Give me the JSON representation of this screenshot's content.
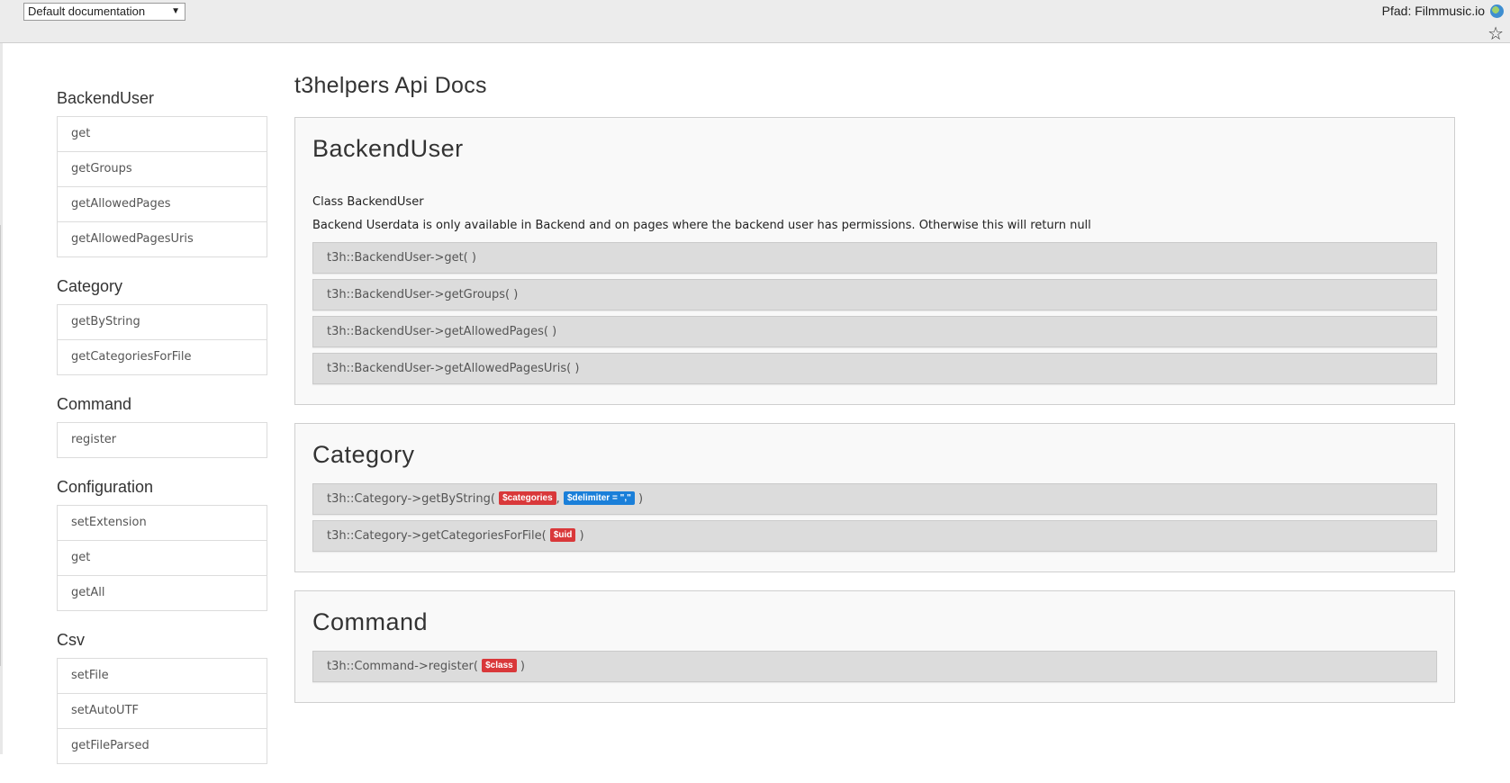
{
  "topbar": {
    "doc_select": "Default documentation",
    "pfad": "Pfad: Filmmusic.io"
  },
  "page_title": "t3helpers Api Docs",
  "sidebar": [
    {
      "title": "BackendUser",
      "items": [
        "get",
        "getGroups",
        "getAllowedPages",
        "getAllowedPagesUris"
      ]
    },
    {
      "title": "Category",
      "items": [
        "getByString",
        "getCategoriesForFile"
      ]
    },
    {
      "title": "Command",
      "items": [
        "register"
      ]
    },
    {
      "title": "Configuration",
      "items": [
        "setExtension",
        "get",
        "getAll"
      ]
    },
    {
      "title": "Csv",
      "items": [
        "setFile",
        "setAutoUTF",
        "getFileParsed"
      ]
    }
  ],
  "panels": [
    {
      "title": "BackendUser",
      "class_line": "Class BackendUser",
      "description": "Backend Userdata is only available in Backend and on pages where the backend user has permissions. Otherwise this will return null",
      "methods": [
        {
          "call": "t3h::BackendUser->get(",
          "params": [],
          "close": ")"
        },
        {
          "call": "t3h::BackendUser->getGroups(",
          "params": [],
          "close": ")"
        },
        {
          "call": "t3h::BackendUser->getAllowedPages(",
          "params": [],
          "close": ")"
        },
        {
          "call": "t3h::BackendUser->getAllowedPagesUris(",
          "params": [],
          "close": ")"
        }
      ]
    },
    {
      "title": "Category",
      "methods": [
        {
          "call": "t3h::Category->getByString(",
          "params": [
            {
              "label": "$categories",
              "color": "red"
            },
            {
              "label": "$delimiter = \",\"",
              "color": "blue"
            }
          ],
          "separator": ",",
          "close": ")"
        },
        {
          "call": "t3h::Category->getCategoriesForFile(",
          "params": [
            {
              "label": "$uid",
              "color": "red"
            }
          ],
          "close": ")"
        }
      ]
    },
    {
      "title": "Command",
      "methods": [
        {
          "call": "t3h::Command->register(",
          "params": [
            {
              "label": "$class",
              "color": "red"
            }
          ],
          "close": ")"
        }
      ]
    }
  ],
  "colors": {
    "badge_red": "#d9383a",
    "badge_blue": "#1a7fd9",
    "method_bg": "#dcdcdc",
    "panel_bg": "#f9f9f9"
  }
}
